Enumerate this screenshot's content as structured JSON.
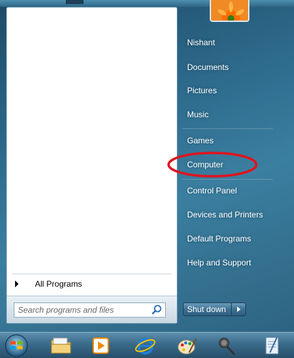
{
  "user": {
    "name": "Nishant"
  },
  "right_links": [
    {
      "label": "Nishant"
    },
    {
      "label": "Documents"
    },
    {
      "label": "Pictures"
    },
    {
      "label": "Music"
    },
    {
      "label": "Games"
    },
    {
      "label": "Computer"
    },
    {
      "label": "Control Panel"
    },
    {
      "label": "Devices and Printers"
    },
    {
      "label": "Default Programs"
    },
    {
      "label": "Help and Support"
    }
  ],
  "left_panel": {
    "all_programs_label": "All Programs",
    "search_placeholder": "Search programs and files"
  },
  "shutdown": {
    "label": "Shut down"
  },
  "annotation": {
    "color": "#e0141e",
    "target": "Computer"
  },
  "taskbar": {
    "icons": [
      "windows-orb-icon",
      "folder-icon",
      "media-player-icon",
      "internet-explorer-icon",
      "paint-icon",
      "microphone-icon",
      "notepad-icon"
    ]
  },
  "colors": {
    "menu_glass": "#2d6a8c",
    "link_text": "#ffffff",
    "left_panel_bg": "#ffffff"
  }
}
